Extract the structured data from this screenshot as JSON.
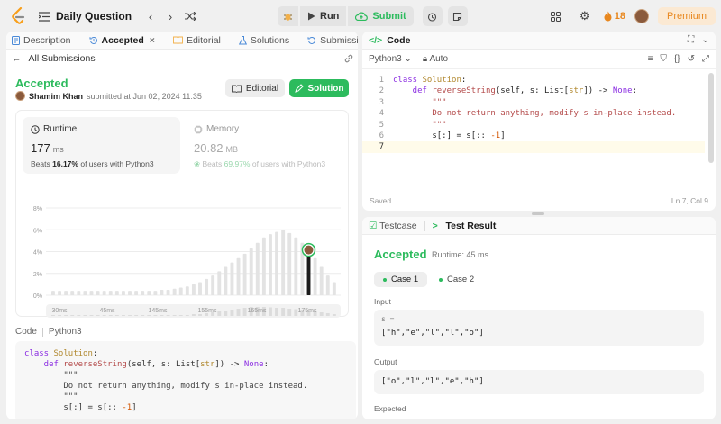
{
  "topbar": {
    "title": "Daily Question",
    "run_label": "Run",
    "submit_label": "Submit",
    "streak": "18",
    "premium_label": "Premium"
  },
  "left_tabs": [
    {
      "label": "Description"
    },
    {
      "label": "Accepted",
      "close": "×"
    },
    {
      "label": "Editorial"
    },
    {
      "label": "Solutions"
    },
    {
      "label": "Submissions"
    }
  ],
  "submission": {
    "back_label": "All Submissions",
    "status": "Accepted",
    "user": "Shamim Khan",
    "submitted_text": "submitted at Jun 02, 2024 11:35",
    "editorial_button": "Editorial",
    "solution_button": "Solution"
  },
  "runtime": {
    "label": "Runtime",
    "value": "177",
    "unit": "ms",
    "beats_prefix": "Beats",
    "beats_pct": "16.17%",
    "beats_suffix": "of users with Python3"
  },
  "memory": {
    "label": "Memory",
    "value": "20.82",
    "unit": "MB",
    "beats_prefix": "Beats",
    "beats_pct": "69.97%",
    "beats_suffix": "of users with Python3"
  },
  "chart_data": {
    "type": "bar",
    "ylim": [
      0,
      8
    ],
    "ytick_labels": [
      "8%",
      "6%",
      "4%",
      "2%",
      "0%"
    ],
    "yticks": [
      8,
      6,
      4,
      2,
      0
    ],
    "xtick_labels": [
      "30ms",
      "45ms",
      "145ms",
      "155ms",
      "165ms",
      "175ms"
    ],
    "values": [
      0.4,
      0.4,
      0.4,
      0.4,
      0.4,
      0.4,
      0.4,
      0.4,
      0.4,
      0.4,
      0.4,
      0.4,
      0.4,
      0.4,
      0.4,
      0.4,
      0.4,
      0.5,
      0.5,
      0.6,
      0.7,
      0.8,
      1.0,
      1.2,
      1.5,
      1.8,
      2.2,
      2.6,
      3.0,
      3.4,
      3.8,
      4.3,
      4.8,
      5.3,
      5.6,
      5.8,
      6.0,
      5.7,
      5.3,
      4.8,
      4.4,
      3.4,
      2.6,
      1.8,
      1.2
    ],
    "highlight_index": 40,
    "highlight_value": 3.0,
    "grid": true,
    "overview_values": [
      0.1,
      0.1,
      0.1,
      0.1,
      0.1,
      0.1,
      0.1,
      0.1,
      0.1,
      0.1,
      0.1,
      0.1,
      0.1,
      0.1,
      0.1,
      0.1,
      0.1,
      0.1,
      0.1,
      0.1,
      0.1,
      0.1,
      0.2,
      0.2,
      0.3,
      0.4,
      0.5,
      0.6,
      0.7,
      0.8,
      0.9,
      1.0,
      1.0,
      1.0,
      0.95,
      0.9,
      0.9,
      0.8,
      0.75,
      0.7,
      0.6,
      0.5,
      0.4,
      0.3,
      0.2
    ]
  },
  "code_section": {
    "label": "Code",
    "language": "Python3"
  },
  "code_lines": [
    [
      {
        "t": "class ",
        "c": "kw"
      },
      {
        "t": "Solution",
        "c": "ty"
      },
      {
        "t": ":",
        "c": ""
      }
    ],
    [
      {
        "t": "    def ",
        "c": "kw"
      },
      {
        "t": "reverseString",
        "c": "fn"
      },
      {
        "t": "(self, s: ",
        "c": ""
      },
      {
        "t": "List",
        "c": ""
      },
      {
        "t": "[",
        "c": ""
      },
      {
        "t": "str",
        "c": "ty"
      },
      {
        "t": "]) -> ",
        "c": ""
      },
      {
        "t": "None",
        "c": "kw"
      },
      {
        "t": ":",
        "c": ""
      }
    ],
    [
      {
        "t": "        \"\"\"",
        "c": "st"
      }
    ],
    [
      {
        "t": "        Do not return anything, modify s in-place instead.",
        "c": "st"
      }
    ],
    [
      {
        "t": "        \"\"\"",
        "c": "st"
      }
    ],
    [
      {
        "t": "        s[:] = s[:: ",
        "c": ""
      },
      {
        "t": "-1",
        "c": "num"
      },
      {
        "t": "]",
        "c": ""
      }
    ]
  ],
  "editor": {
    "title": "Code",
    "language": "Python3",
    "auto_label": "Auto",
    "status": "Saved",
    "cursor": "Ln 7, Col 9",
    "line_numbers": [
      "1",
      "2",
      "3",
      "4",
      "5",
      "6",
      "7"
    ]
  },
  "editor_lines": [
    [
      {
        "t": "class ",
        "c": "kw"
      },
      {
        "t": "Solution",
        "c": "ty"
      },
      {
        "t": ":",
        "c": ""
      }
    ],
    [
      {
        "t": "    def ",
        "c": "kw"
      },
      {
        "t": "reverseString",
        "c": "fn"
      },
      {
        "t": "(self, s: List[",
        "c": ""
      },
      {
        "t": "str",
        "c": "ty"
      },
      {
        "t": "]) -> ",
        "c": ""
      },
      {
        "t": "None",
        "c": "kw"
      },
      {
        "t": ":",
        "c": ""
      }
    ],
    [
      {
        "t": "        \"\"\"",
        "c": "fn"
      }
    ],
    [
      {
        "t": "        Do not return anything, modify s in-place instead.",
        "c": "fn"
      }
    ],
    [
      {
        "t": "        \"\"\"",
        "c": "fn"
      }
    ],
    [
      {
        "t": "        s[:] = s[:: ",
        "c": ""
      },
      {
        "t": "-1",
        "c": "num"
      },
      {
        "t": "]",
        "c": ""
      }
    ],
    [
      {
        "t": "",
        "c": ""
      }
    ]
  ],
  "result": {
    "tab_testcase": "Testcase",
    "tab_result": "Test Result",
    "status": "Accepted",
    "runtime": "Runtime: 45 ms",
    "case1": "Case 1",
    "case2": "Case 2",
    "input_label": "Input",
    "input_var": "s =",
    "input_value": "[\"h\",\"e\",\"l\",\"l\",\"o\"]",
    "output_label": "Output",
    "output_value": "[\"o\",\"l\",\"l\",\"e\",\"h\"]",
    "expected_label": "Expected"
  },
  "colors": {
    "accent_green": "#2cbb5d",
    "accent_orange": "#e8871e",
    "bar_gray": "#e3e3e3",
    "bar_highlight": "#1a1a1a"
  }
}
